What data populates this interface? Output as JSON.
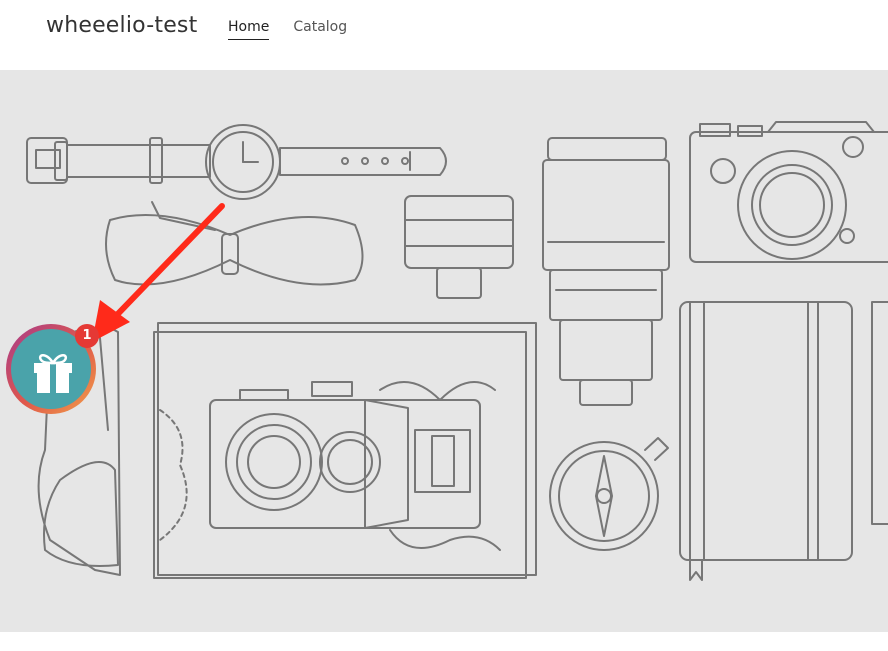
{
  "store": {
    "name": "wheeelio-test"
  },
  "nav": {
    "items": [
      {
        "label": "Home",
        "active": true
      },
      {
        "label": "Catalog",
        "active": false
      }
    ]
  },
  "hero": {
    "illustration": "line-art collage: watch, bow tie, sunglasses, lens, camera, map, compass, notebook",
    "background": "#e6e6e6"
  },
  "gift_widget": {
    "badge_count": "1",
    "icon": "gift-icon",
    "colors": {
      "inner": "#4aa3aa",
      "badge": "#e53935"
    }
  },
  "annotation": {
    "arrow_color": "#ff2a1a"
  }
}
